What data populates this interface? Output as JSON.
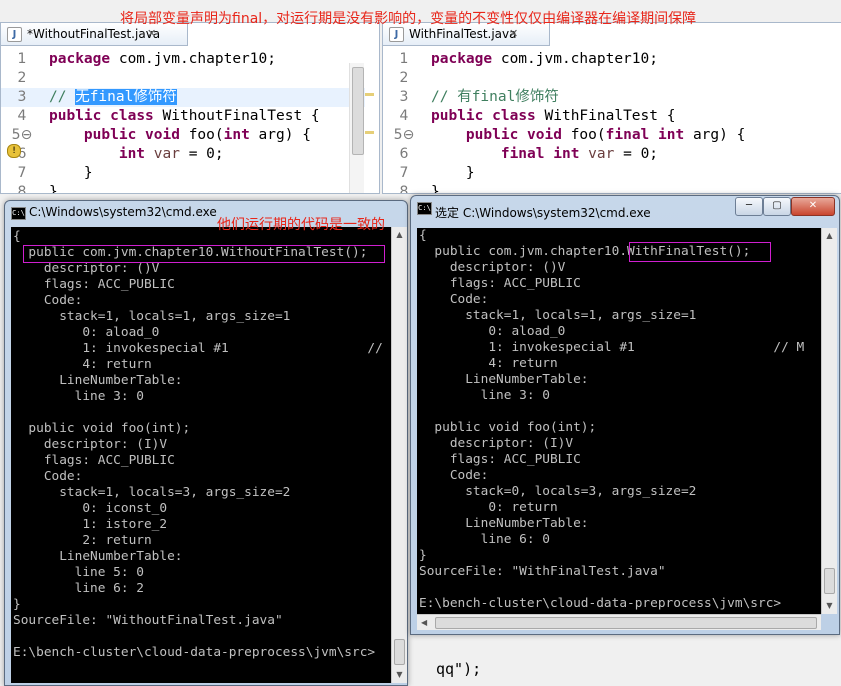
{
  "annotations": {
    "top": "将局部变量声明为final，对运行期是没有影响的，变量的不变性仅仅由编译器在编译期间保障",
    "middle": "他们运行期的代码是一致的"
  },
  "left_editor": {
    "tab_label": "*WithoutFinalTest.java",
    "tab_close": "✕",
    "lines": [
      {
        "num": "1",
        "tokens": [
          [
            "kw",
            "package"
          ],
          [
            "t",
            " com.jvm.chapter10;"
          ]
        ]
      },
      {
        "num": "2",
        "tokens": []
      },
      {
        "num": "3",
        "tokens": [
          [
            "cm",
            "// "
          ],
          [
            "sel",
            "无final修饰符"
          ]
        ]
      },
      {
        "num": "4",
        "tokens": [
          [
            "kw",
            "public"
          ],
          [
            "t",
            " "
          ],
          [
            "kw",
            "class"
          ],
          [
            "t",
            " WithoutFinalTest {"
          ]
        ]
      },
      {
        "num": "5⊖",
        "tokens": [
          [
            "t",
            "    "
          ],
          [
            "kw",
            "public"
          ],
          [
            "t",
            " "
          ],
          [
            "kw",
            "void"
          ],
          [
            "t",
            " foo("
          ],
          [
            "kw",
            "int"
          ],
          [
            "t",
            " arg) {"
          ]
        ]
      },
      {
        "num": "6",
        "tokens": [
          [
            "t",
            "        "
          ],
          [
            "kw",
            "int"
          ],
          [
            "t",
            " "
          ],
          [
            "var",
            "var"
          ],
          [
            "t",
            " = 0;"
          ]
        ]
      },
      {
        "num": "7",
        "tokens": [
          [
            "t",
            "    }"
          ]
        ]
      },
      {
        "num": "8",
        "tokens": [
          [
            "t",
            "}"
          ]
        ]
      }
    ]
  },
  "right_editor": {
    "tab_label": "WithFinalTest.java",
    "tab_close": "✕",
    "lines": [
      {
        "num": "1",
        "tokens": [
          [
            "kw",
            "package"
          ],
          [
            "t",
            " com.jvm.chapter10;"
          ]
        ]
      },
      {
        "num": "2",
        "tokens": []
      },
      {
        "num": "3",
        "tokens": [
          [
            "cm",
            "// 有final修饰符"
          ]
        ]
      },
      {
        "num": "4",
        "tokens": [
          [
            "kw",
            "public"
          ],
          [
            "t",
            " "
          ],
          [
            "kw",
            "class"
          ],
          [
            "t",
            " WithFinalTest {"
          ]
        ]
      },
      {
        "num": "5⊖",
        "tokens": [
          [
            "t",
            "    "
          ],
          [
            "kw",
            "public"
          ],
          [
            "t",
            " "
          ],
          [
            "kw",
            "void"
          ],
          [
            "t",
            " foo("
          ],
          [
            "kw",
            "final"
          ],
          [
            "t",
            " "
          ],
          [
            "kw",
            "int"
          ],
          [
            "t",
            " arg) {"
          ]
        ]
      },
      {
        "num": "6",
        "tokens": [
          [
            "t",
            "        "
          ],
          [
            "kw",
            "final"
          ],
          [
            "t",
            " "
          ],
          [
            "kw",
            "int"
          ],
          [
            "t",
            " "
          ],
          [
            "var",
            "var"
          ],
          [
            "t",
            " = 0;"
          ]
        ]
      },
      {
        "num": "7",
        "tokens": [
          [
            "t",
            "    }"
          ]
        ]
      },
      {
        "num": "8",
        "tokens": [
          [
            "t",
            "}"
          ]
        ]
      }
    ]
  },
  "left_cmd": {
    "title": "C:\\Windows\\system32\\cmd.exe",
    "lines": [
      "{",
      "  public com.jvm.chapter10.WithoutFinalTest();",
      "    descriptor: ()V",
      "    flags: ACC_PUBLIC",
      "    Code:",
      "      stack=1, locals=1, args_size=1",
      "         0: aload_0",
      "         1: invokespecial #1                  //",
      "         4: return",
      "      LineNumberTable:",
      "        line 3: 0",
      "",
      "  public void foo(int);",
      "    descriptor: (I)V",
      "    flags: ACC_PUBLIC",
      "    Code:",
      "      stack=1, locals=3, args_size=2",
      "         0: iconst_0",
      "         1: istore_2",
      "         2: return",
      "      LineNumberTable:",
      "        line 5: 0",
      "        line 6: 2",
      "}",
      "SourceFile: \"WithoutFinalTest.java\"",
      "",
      "E:\\bench-cluster\\cloud-data-preprocess\\jvm\\src>"
    ]
  },
  "right_cmd": {
    "title": "选定 C:\\Windows\\system32\\cmd.exe",
    "lines": [
      "{",
      "  public com.jvm.chapter10.WithFinalTest();",
      "    descriptor: ()V",
      "    flags: ACC_PUBLIC",
      "    Code:",
      "      stack=1, locals=1, args_size=1",
      "         0: aload_0",
      "         1: invokespecial #1                  // M",
      "         4: return",
      "      LineNumberTable:",
      "        line 3: 0",
      "",
      "  public void foo(int);",
      "    descriptor: (I)V",
      "    flags: ACC_PUBLIC",
      "    Code:",
      "      stack=0, locals=3, args_size=2",
      "         0: return",
      "      LineNumberTable:",
      "        line 6: 0",
      "}",
      "SourceFile: \"WithFinalTest.java\"",
      "",
      "E:\\bench-cluster\\cloud-data-preprocess\\jvm\\src>"
    ]
  },
  "background_code": {
    "text": "qq\");"
  },
  "window_buttons": {
    "min": "─",
    "max": "▢",
    "close": "✕"
  }
}
